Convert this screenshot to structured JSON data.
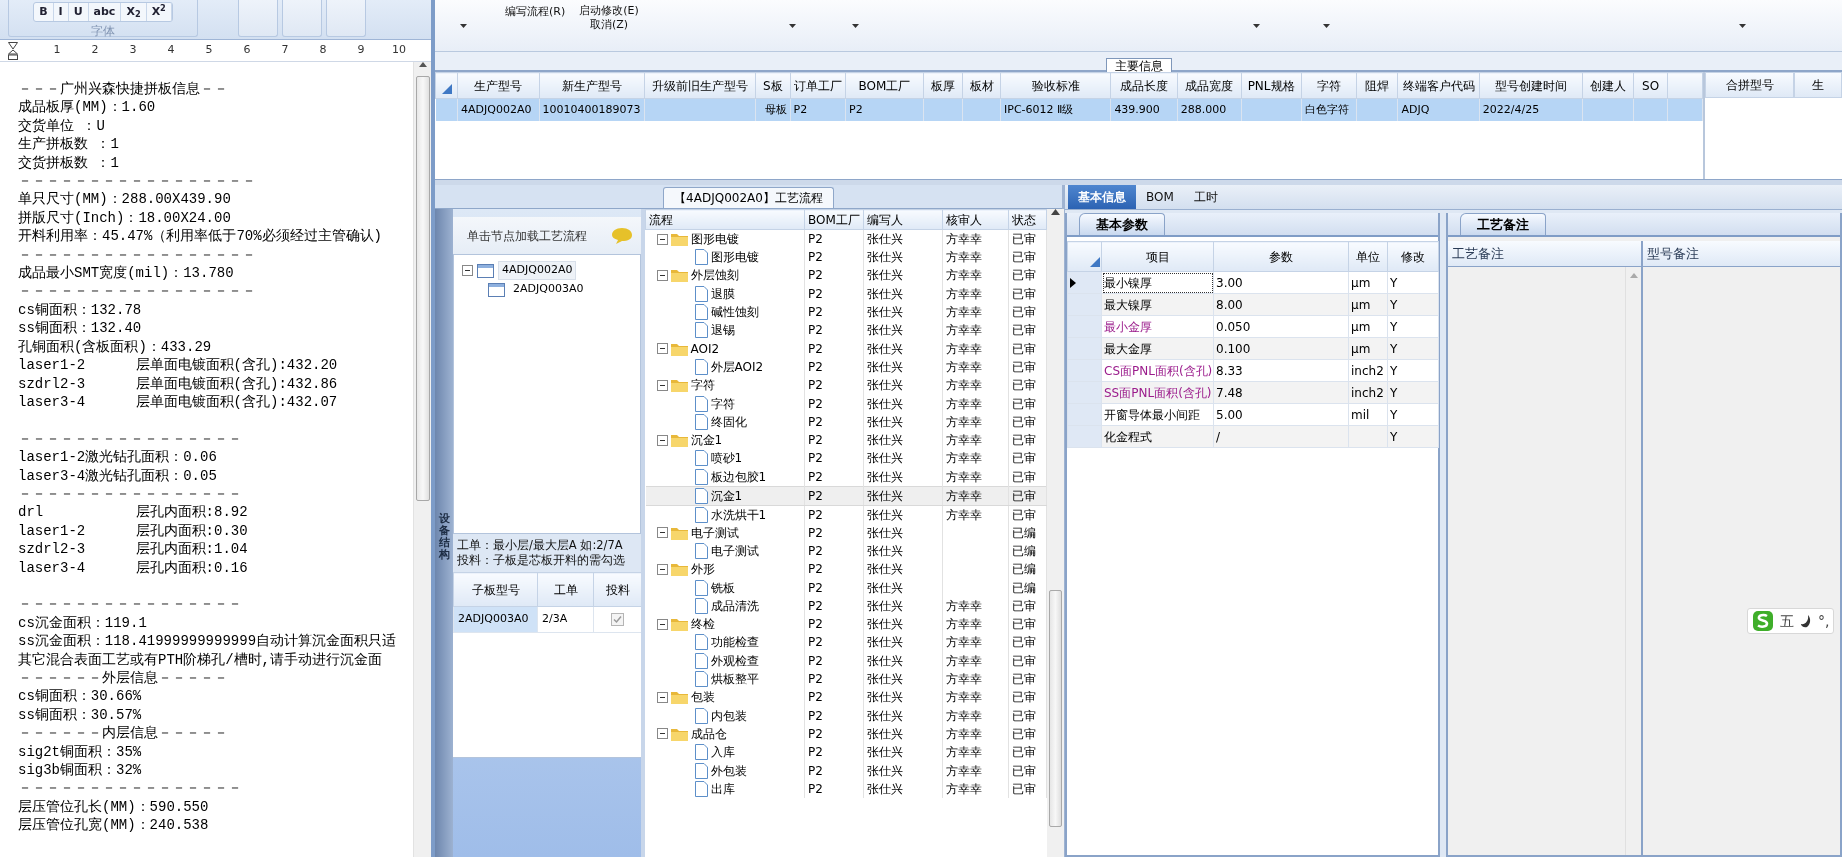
{
  "document": {
    "format_buttons": [
      "B",
      "I",
      "U",
      "abc",
      "X$_{2}$",
      "X$^{2}$"
    ],
    "font_group_label": "字体",
    "ruler_marks": [
      "1",
      "2",
      "3",
      "4",
      "5",
      "6",
      "7",
      "8",
      "9",
      "10"
    ],
    "paragraphs": [
      [
        "－－－广州兴森快捷拼板信息－－",
        "成品板厚(MM)：1.60",
        "交货单位 ：U",
        "生产拼板数 ：1",
        "交货拼板数 ：1",
        "－－－－－－－－－－－－－－－－－",
        "单只尺寸(MM)：288.00X439.90",
        "拼版尺寸(Inch)：18.00X24.00",
        "开料利用率：45.47%（利用率低于70%必须经过主管确认)",
        "－－－－－－－－－－－－－－－－－",
        "成品最小SMT宽度(mil)：13.780",
        "－－－－－－－－－－－－－－－－－",
        "cs铜面积：132.78",
        "ss铜面积：132.40",
        "孔铜面积(含板面积)：433.29",
        "laser1-2      层单面电镀面积(含孔):432.20",
        "szdrl2-3      层单面电镀面积(含孔):432.86",
        "laser3-4      层单面电镀面积(含孔):432.07"
      ],
      [
        "－－－－－－－－－－－－－－－－",
        "laser1-2激光钻孔面积：0.06",
        "laser3-4激光钻孔面积：0.05",
        "－－－－－－－－－－－－－－－－",
        "drl           层孔内面积:8.92",
        "laser1-2      层孔内面积:0.30",
        "szdrl2-3      层孔内面积:1.04",
        "laser3-4      层孔内面积:0.16"
      ],
      [
        "－－－－－－－－－－－－－－－－",
        "cs沉金面积：119.1",
        "ss沉金面积：118.41999999999999自动计算沉金面积只适",
        "其它混合表面工艺或有PTH阶梯孔/槽时,请手动进行沉金面",
        "－－－－－－外层信息－－－－－",
        "cs铜面积：30.66%",
        "ss铜面积：30.57%",
        "－－－－－－内层信息－－－－－",
        "sig2t铜面积：35%",
        "sig3b铜面积：32%",
        "－－－－－－－－－－－－－－－－",
        "层压管位孔长(MM)：590.550",
        "层压管位孔宽(MM)：240.538"
      ]
    ]
  },
  "toolbar": {
    "commands": [
      {
        "label": "编写流程(R)"
      },
      {
        "label": "启动修改(E)"
      },
      {
        "label": "取消(Z)"
      }
    ]
  },
  "main_info": {
    "title": "主要信息",
    "table": {
      "row_selected": true,
      "columns": [
        {
          "header": "生产型号",
          "cell": "4ADJQ002A0"
        },
        {
          "header": "新生产型号",
          "cell": "10010400189073"
        },
        {
          "header": "升级前旧生产型号"
        },
        {
          "header": "S板",
          "cell": "母板"
        },
        {
          "header": "订单工厂",
          "cell": "P2"
        },
        {
          "header": "BOM工厂",
          "cell": "P2"
        },
        {
          "header": "板厚"
        },
        {
          "header": "板材"
        },
        {
          "header": "验收标准",
          "cell": "IPC-6012 Ⅱ级"
        },
        {
          "header": "成品长度",
          "cell": "439.900"
        },
        {
          "header": "成品宽度",
          "cell": "288.000"
        },
        {
          "header": "PNL规格"
        },
        {
          "header": "字符",
          "cell": "白色字符"
        },
        {
          "header": "阻焊"
        },
        {
          "header": "终端客户代码",
          "cell": "ADJQ"
        },
        {
          "header": "型号创建时间",
          "cell": "2022/4/25"
        },
        {
          "header": "创建人"
        },
        {
          "header": "SO"
        }
      ]
    },
    "merge_table": {
      "columns": [
        "合拼型号",
        "生"
      ]
    }
  },
  "process_panel": {
    "title": "【4ADJQ002A0】工艺流程",
    "side_tab": "设备结构",
    "tree_hint": "单击节点加载工艺流程",
    "board_tree": [
      {
        "label": "4ADJQ002A0",
        "expanded": true,
        "children": [
          {
            "label": "2ADJQ003A0"
          }
        ]
      }
    ],
    "notes": [
      "工单：最小层/最大层A 如:2/7A",
      "投料：子板是芯板开料的需勾选"
    ],
    "sub_boards": {
      "columns": [
        "子板型号",
        "工单",
        "投料"
      ],
      "rows": [
        {
          "model": "2ADJQ003A0",
          "order": "2/3A",
          "fed": true,
          "selected": true
        }
      ]
    },
    "flow": {
      "columns": [
        "流程",
        "BOM工厂",
        "编写人",
        "核审人",
        "状态"
      ],
      "steps": [
        {
          "name": "图形电镀",
          "bom": "P2",
          "writer": "张仕兴",
          "reviewer": "方幸幸",
          "status": "已审",
          "expanded": true,
          "children": [
            {
              "name": "图形电镀",
              "bom": "P2",
              "writer": "张仕兴",
              "reviewer": "方幸幸",
              "status": "已审",
              "selected": false
            }
          ]
        },
        {
          "name": "外层蚀刻",
          "bom": "P2",
          "writer": "张仕兴",
          "reviewer": "方幸幸",
          "status": "已审",
          "expanded": true,
          "children": [
            {
              "name": "退膜",
              "bom": "P2",
              "writer": "张仕兴",
              "reviewer": "方幸幸",
              "status": "已审",
              "selected": false
            },
            {
              "name": "碱性蚀刻",
              "bom": "P2",
              "writer": "张仕兴",
              "reviewer": "方幸幸",
              "status": "已审",
              "selected": false
            },
            {
              "name": "退锡",
              "bom": "P2",
              "writer": "张仕兴",
              "reviewer": "方幸幸",
              "status": "已审",
              "selected": false
            }
          ]
        },
        {
          "name": "AOI2",
          "bom": "P2",
          "writer": "张仕兴",
          "reviewer": "方幸幸",
          "status": "已审",
          "expanded": true,
          "children": [
            {
              "name": "外层AOI2",
              "bom": "P2",
              "writer": "张仕兴",
              "reviewer": "方幸幸",
              "status": "已审",
              "selected": false
            }
          ]
        },
        {
          "name": "字符",
          "bom": "P2",
          "writer": "张仕兴",
          "reviewer": "方幸幸",
          "status": "已审",
          "expanded": true,
          "children": [
            {
              "name": "字符",
              "bom": "P2",
              "writer": "张仕兴",
              "reviewer": "方幸幸",
              "status": "已审",
              "selected": false
            },
            {
              "name": "终固化",
              "bom": "P2",
              "writer": "张仕兴",
              "reviewer": "方幸幸",
              "status": "已审",
              "selected": false
            }
          ]
        },
        {
          "name": "沉金1",
          "bom": "P2",
          "writer": "张仕兴",
          "reviewer": "方幸幸",
          "status": "已审",
          "expanded": true,
          "children": [
            {
              "name": "喷砂1",
              "bom": "P2",
              "writer": "张仕兴",
              "reviewer": "方幸幸",
              "status": "已审",
              "selected": false
            },
            {
              "name": "板边包胶1",
              "bom": "P2",
              "writer": "张仕兴",
              "reviewer": "方幸幸",
              "status": "已审",
              "selected": false
            },
            {
              "name": "沉金1",
              "bom": "P2",
              "writer": "张仕兴",
              "reviewer": "方幸幸",
              "status": "已审",
              "selected": true
            },
            {
              "name": "水洗烘干1",
              "bom": "P2",
              "writer": "张仕兴",
              "reviewer": "方幸幸",
              "status": "已审",
              "selected": false
            }
          ]
        },
        {
          "name": "电子测试",
          "bom": "P2",
          "writer": "张仕兴",
          "status": "已编",
          "expanded": true,
          "children": [
            {
              "name": "电子测试",
              "bom": "P2",
              "writer": "张仕兴",
              "status": "已编",
              "selected": false
            }
          ]
        },
        {
          "name": "外形",
          "bom": "P2",
          "writer": "张仕兴",
          "status": "已编",
          "expanded": true,
          "children": [
            {
              "name": "铣板",
              "bom": "P2",
              "writer": "张仕兴",
              "status": "已编",
              "selected": false
            },
            {
              "name": "成品清洗",
              "bom": "P2",
              "writer": "张仕兴",
              "reviewer": "方幸幸",
              "status": "已审",
              "selected": false
            }
          ]
        },
        {
          "name": "终检",
          "bom": "P2",
          "writer": "张仕兴",
          "reviewer": "方幸幸",
          "status": "已审",
          "expanded": true,
          "children": [
            {
              "name": "功能检查",
              "bom": "P2",
              "writer": "张仕兴",
              "reviewer": "方幸幸",
              "status": "已审",
              "selected": false
            },
            {
              "name": "外观检查",
              "bom": "P2",
              "writer": "张仕兴",
              "reviewer": "方幸幸",
              "status": "已审",
              "selected": false
            },
            {
              "name": "烘板整平",
              "bom": "P2",
              "writer": "张仕兴",
              "reviewer": "方幸幸",
              "status": "已审",
              "selected": false
            }
          ]
        },
        {
          "name": "包装",
          "bom": "P2",
          "writer": "张仕兴",
          "reviewer": "方幸幸",
          "status": "已审",
          "expanded": true,
          "children": [
            {
              "name": "内包装",
              "bom": "P2",
              "writer": "张仕兴",
              "reviewer": "方幸幸",
              "status": "已审",
              "selected": false
            }
          ]
        },
        {
          "name": "成品仓",
          "bom": "P2",
          "writer": "张仕兴",
          "reviewer": "方幸幸",
          "status": "已审",
          "expanded": true,
          "children": [
            {
              "name": "入库",
              "bom": "P2",
              "writer": "张仕兴",
              "reviewer": "方幸幸",
              "status": "已审",
              "selected": false
            },
            {
              "name": "外包装",
              "bom": "P2",
              "writer": "张仕兴",
              "reviewer": "方幸幸",
              "status": "已审",
              "selected": false
            },
            {
              "name": "出库",
              "bom": "P2",
              "writer": "张仕兴",
              "reviewer": "方幸幸",
              "status": "已审",
              "selected": false
            }
          ]
        }
      ]
    }
  },
  "detail_panel": {
    "tabs": [
      {
        "label": "基本信息",
        "selected": true
      },
      {
        "label": "BOM",
        "selected": false
      },
      {
        "label": "工时",
        "selected": false
      }
    ],
    "params": {
      "title": "基本参数",
      "columns": [
        "项目",
        "参数",
        "单位",
        "修改"
      ],
      "rows": [
        {
          "item": "最小镍厚",
          "value": "3.00",
          "unit": "µm",
          "editable": "Y",
          "highlighted": false,
          "current": true
        },
        {
          "item": "最大镍厚",
          "value": "8.00",
          "unit": "µm",
          "editable": "Y",
          "highlighted": false,
          "current": false
        },
        {
          "item": "最小金厚",
          "value": "0.050",
          "unit": "µm",
          "editable": "Y",
          "highlighted": true,
          "current": false
        },
        {
          "item": "最大金厚",
          "value": "0.100",
          "unit": "µm",
          "editable": "Y",
          "highlighted": false,
          "current": false
        },
        {
          "item": "CS面PNL面积(含孔)",
          "value": "8.33",
          "unit": "inch2",
          "editable": "Y",
          "highlighted": true,
          "current": false
        },
        {
          "item": "SS面PNL面积(含孔)",
          "value": "7.48",
          "unit": "inch2",
          "editable": "Y",
          "highlighted": true,
          "current": false
        },
        {
          "item": "开窗导体最小间距",
          "value": "5.00",
          "unit": "mil",
          "editable": "Y",
          "highlighted": false,
          "current": false
        },
        {
          "item": "化金程式",
          "value": "/",
          "editable": "Y",
          "highlighted": false,
          "current": false
        }
      ]
    },
    "notes": {
      "title": "工艺备注",
      "columns": [
        "工艺备注",
        "型号备注"
      ]
    }
  },
  "ime": {
    "mode": "五",
    "punctuation": "°,"
  }
}
